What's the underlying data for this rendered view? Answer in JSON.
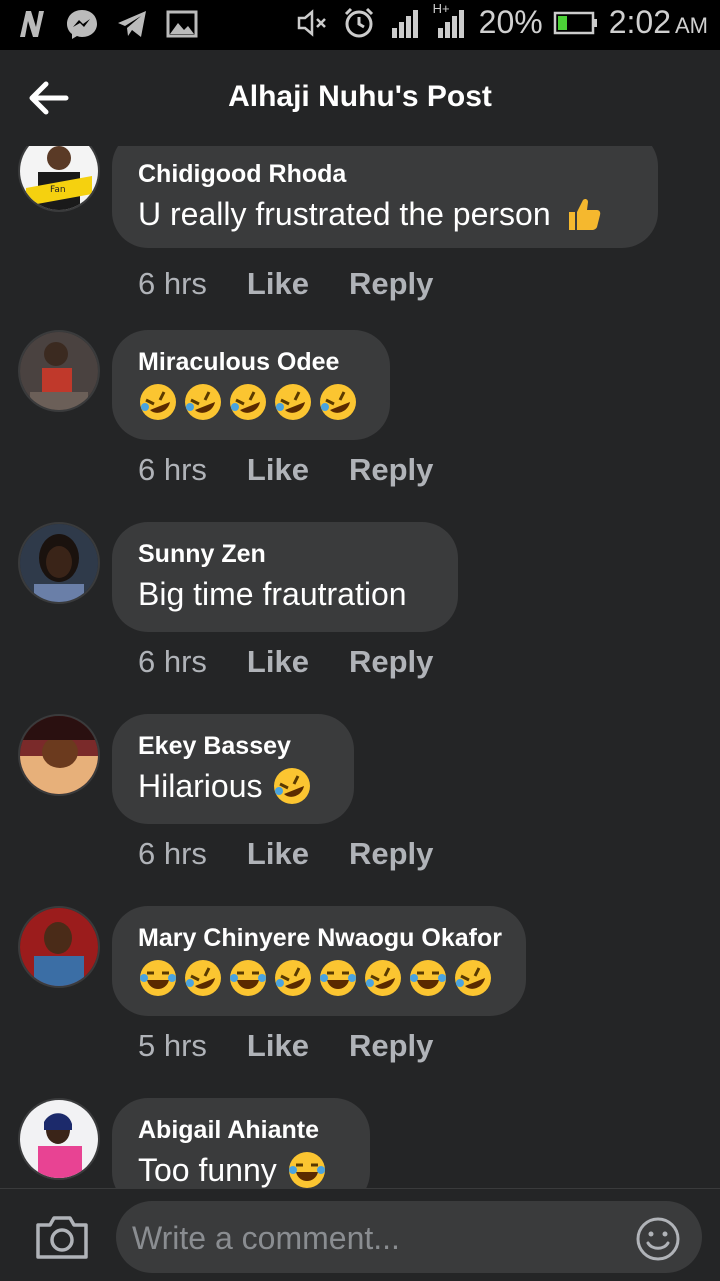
{
  "status_bar": {
    "battery": "20%",
    "time": "2:02",
    "ampm": "AM",
    "network": "H+"
  },
  "header": {
    "title": "Alhaji Nuhu's Post",
    "back_icon": "arrow-left-icon"
  },
  "comments": [
    {
      "name": "Chidigood Rhoda",
      "text": "U really frustrated the person",
      "emojis": [
        "thumbs-up"
      ],
      "time": "6 hrs",
      "like": "Like",
      "reply": "Reply"
    },
    {
      "name": "Miraculous Odee",
      "text": "",
      "emojis": [
        "rofl",
        "rofl",
        "rofl",
        "rofl",
        "rofl"
      ],
      "time": "6 hrs",
      "like": "Like",
      "reply": "Reply"
    },
    {
      "name": "Sunny Zen",
      "text": "Big time frautration",
      "emojis": [],
      "time": "6 hrs",
      "like": "Like",
      "reply": "Reply"
    },
    {
      "name": "Ekey Bassey",
      "text": "Hilarious",
      "emojis": [
        "rofl"
      ],
      "time": "6 hrs",
      "like": "Like",
      "reply": "Reply"
    },
    {
      "name": "Mary Chinyere Nwaogu Okafor",
      "text": "",
      "emojis": [
        "joy",
        "rofl",
        "joy",
        "rofl",
        "joy",
        "rofl",
        "joy",
        "rofl"
      ],
      "time": "5 hrs",
      "like": "Like",
      "reply": "Reply"
    },
    {
      "name": "Abigail Ahiante",
      "text": "Too funny",
      "emojis": [
        "joy"
      ],
      "time": "",
      "like": "",
      "reply": ""
    }
  ],
  "composer": {
    "placeholder": "Write a comment...",
    "camera_icon": "camera-icon",
    "emoji_icon": "smiley-icon"
  },
  "colors": {
    "background": "#242526",
    "bubble": "#3a3b3c",
    "meta_text": "#b0b3b8"
  }
}
